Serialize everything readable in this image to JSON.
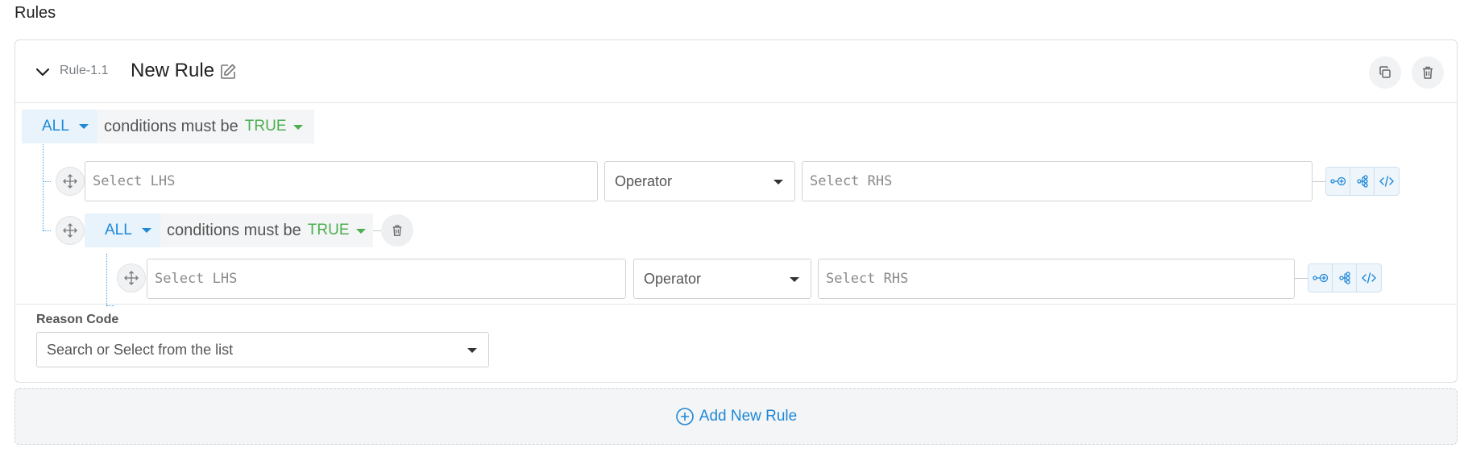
{
  "page": {
    "section_title": "Rules"
  },
  "rule": {
    "id": "Rule-1.1",
    "name": "New Rule",
    "copy_icon": "copy-icon",
    "delete_icon": "trash-icon"
  },
  "group1": {
    "combinator": "ALL",
    "must_be_text": "conditions must be",
    "truth": "TRUE",
    "condition": {
      "lhs_placeholder": "Select LHS",
      "operator": "Operator",
      "rhs_placeholder": "Select RHS"
    }
  },
  "group2": {
    "combinator": "ALL",
    "must_be_text": "conditions must be",
    "truth": "TRUE",
    "condition": {
      "lhs_placeholder": "Select LHS",
      "operator": "Operator",
      "rhs_placeholder": "Select RHS"
    }
  },
  "reason": {
    "label": "Reason Code",
    "placeholder": "Search or Select from the list"
  },
  "add_rule": {
    "label": "Add New Rule"
  },
  "colors": {
    "accent_blue": "#1e88d8",
    "true_green": "#4caf50",
    "border": "#dcdfe3"
  },
  "icons": [
    "chevron-down-icon",
    "edit-icon",
    "copy-icon",
    "trash-icon",
    "move-icon",
    "add-condition-icon",
    "add-group-icon",
    "code-icon",
    "plus-circle-icon"
  ]
}
